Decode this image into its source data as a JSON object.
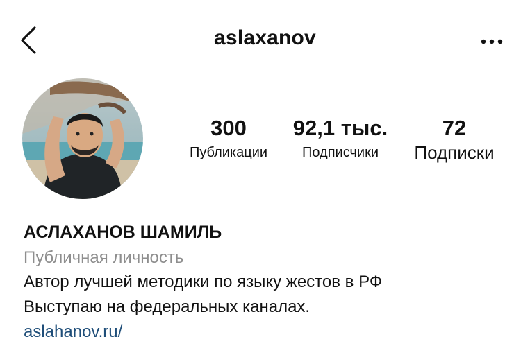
{
  "header": {
    "username": "aslaxanov",
    "back_icon": "chevron-left-icon",
    "more_icon": "more-horizontal-icon"
  },
  "profile": {
    "avatar": "profile-photo",
    "stats": [
      {
        "value": "300",
        "label": "Публикации"
      },
      {
        "value": "92,1 тыс.",
        "label": "Подписчики"
      },
      {
        "value": "72",
        "label": "Подписки"
      }
    ],
    "name": "АСЛАХАНОВ ШАМИЛЬ",
    "category": "Публичная личность",
    "bio_lines": [
      "Автор лучшей методики по языку жестов в РФ",
      "Выступаю на федеральных каналах."
    ],
    "link": "aslahanov.ru/"
  },
  "colors": {
    "text": "#111111",
    "muted": "#8e8e8e",
    "link": "#1f4e79"
  }
}
